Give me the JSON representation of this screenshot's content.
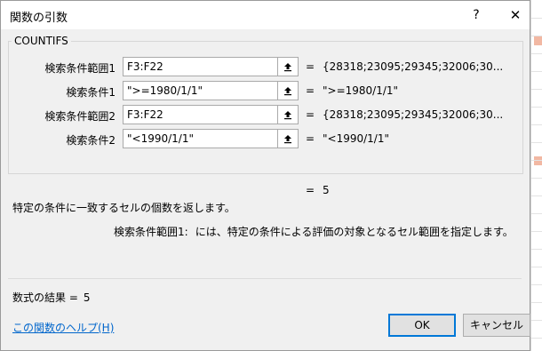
{
  "window": {
    "title": "関数の引数",
    "help_label": "?",
    "close_label": "✕"
  },
  "function_name": "COUNTIFS",
  "arguments": [
    {
      "label": "検索条件範囲1",
      "input": "F3:F22",
      "eq": "=",
      "value": "{28318;23095;29345;32006;30..."
    },
    {
      "label": "検索条件1",
      "input": "\">=1980/1/1\"",
      "eq": "=",
      "value": "\">=1980/1/1\""
    },
    {
      "label": "検索条件範囲2",
      "input": "F3:F22",
      "eq": "=",
      "value": "{28318;23095;29345;32006;30..."
    },
    {
      "label": "検索条件2",
      "input": "\"<1990/1/1\"",
      "eq": "=",
      "value": "\"<1990/1/1\""
    }
  ],
  "function_result": {
    "eq": "=",
    "value": "5"
  },
  "description": "特定の条件に一致するセルの個数を返します。",
  "argument_help": {
    "name": "検索条件範囲1:",
    "text": "には、特定の条件による評価の対象となるセル範囲を指定します。"
  },
  "formula_result": {
    "label": "数式の結果 =",
    "value": "5"
  },
  "help_link": "この関数のヘルプ(H)",
  "buttons": {
    "ok": "OK",
    "cancel": "キャンセル"
  },
  "icons": {
    "ref_button": "collapse-dialog-icon",
    "close": "close-icon"
  },
  "colors": {
    "accent": "#0078d7",
    "link": "#0066cc",
    "dialog_bg": "#f0f0f0"
  }
}
